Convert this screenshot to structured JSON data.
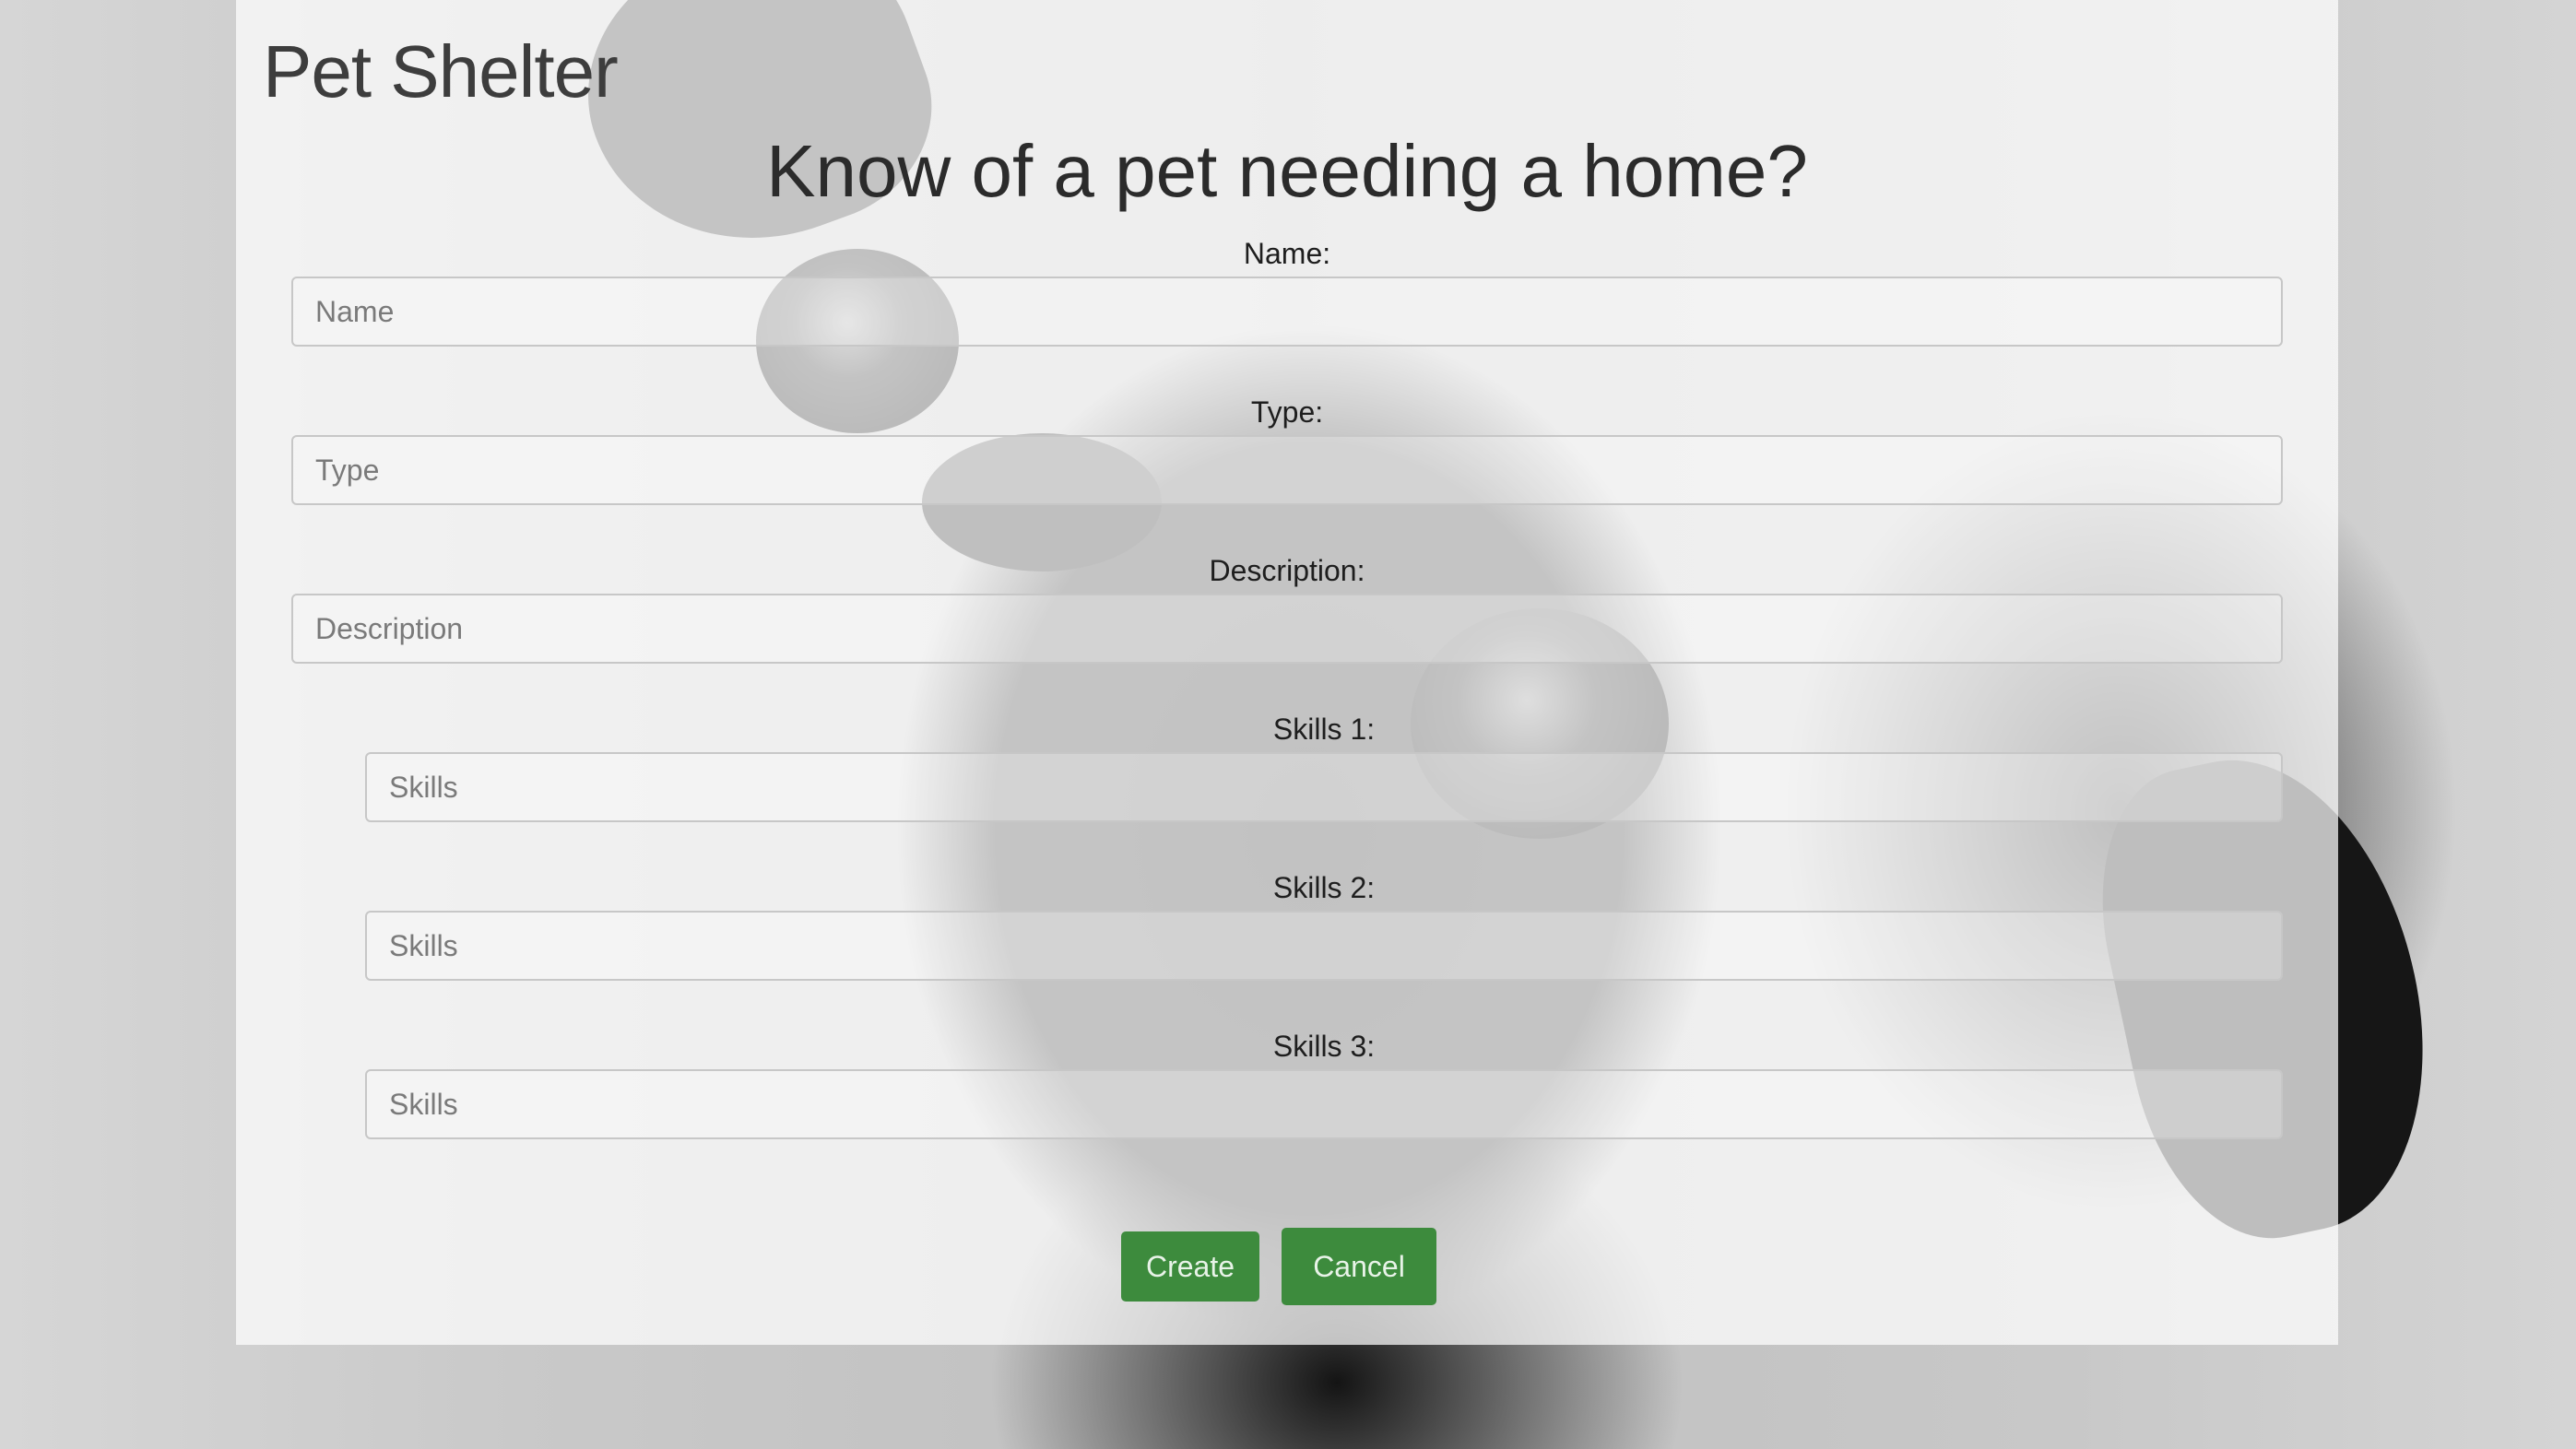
{
  "app": {
    "brand": "Pet Shelter"
  },
  "form": {
    "heading": "Know of a pet needing a home?",
    "fields": {
      "name": {
        "label": "Name:",
        "placeholder": "Name",
        "value": ""
      },
      "type": {
        "label": "Type:",
        "placeholder": "Type",
        "value": ""
      },
      "description": {
        "label": "Description:",
        "placeholder": "Description",
        "value": ""
      },
      "skill1": {
        "label": "Skills 1:",
        "placeholder": "Skills",
        "value": ""
      },
      "skill2": {
        "label": "Skills 2:",
        "placeholder": "Skills",
        "value": ""
      },
      "skill3": {
        "label": "Skills 3:",
        "placeholder": "Skills",
        "value": ""
      }
    },
    "buttons": {
      "create": "Create",
      "cancel": "Cancel"
    }
  },
  "colors": {
    "button_green": "#3d8b3d",
    "panel_white": "#ffffff"
  }
}
